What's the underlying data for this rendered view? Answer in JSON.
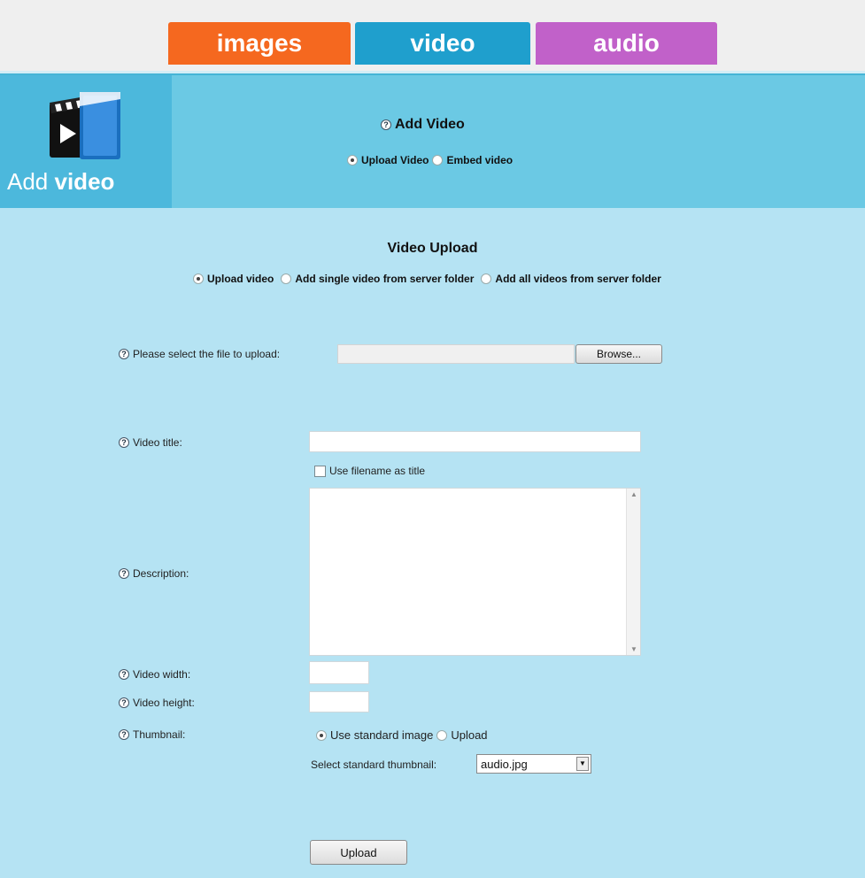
{
  "tabs": [
    {
      "label": "images",
      "color": "#f5681f"
    },
    {
      "label": "video",
      "color": "#1f9fcd"
    },
    {
      "label": "audio",
      "color": "#c161c9"
    }
  ],
  "header": {
    "logo_text_1": "Add",
    "logo_text_2": "video",
    "title": "Add Video",
    "options": [
      "Upload Video",
      "Embed video"
    ],
    "selected": "Upload Video"
  },
  "form": {
    "title": "Video Upload",
    "source_options": [
      "Upload video",
      "Add single video from server folder",
      "Add all videos from server folder"
    ],
    "source_selected": "Upload video",
    "file_label": "Please select the file to upload:",
    "file_value": "",
    "browse_label": "Browse...",
    "title_label": "Video title:",
    "title_value": "",
    "use_filename_label": "Use filename as title",
    "use_filename_checked": false,
    "description_label": "Description:",
    "description_value": "",
    "width_label": "Video width:",
    "width_value": "",
    "height_label": "Video height:",
    "height_value": "",
    "thumbnail_label": "Thumbnail:",
    "thumbnail_options": [
      "Use standard image",
      "Upload"
    ],
    "thumbnail_selected": "Use standard image",
    "std_thumb_label": "Select standard thumbnail:",
    "std_thumb_value": "audio.jpg",
    "upload_button": "Upload"
  },
  "colors": {
    "background": "#b5e3f3",
    "header": "#6bc9e4",
    "logo_panel": "#4cb8dc"
  }
}
